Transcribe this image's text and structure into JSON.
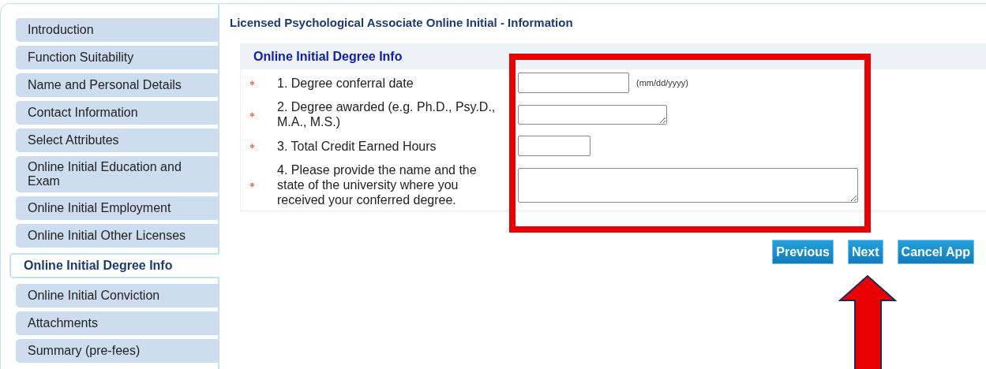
{
  "sidebar": {
    "items": [
      {
        "label": "Introduction",
        "selected": false
      },
      {
        "label": "Function Suitability",
        "selected": false
      },
      {
        "label": "Name and Personal Details",
        "selected": false
      },
      {
        "label": "Contact Information",
        "selected": false
      },
      {
        "label": "Select Attributes",
        "selected": false
      },
      {
        "label": "Online Initial Education and Exam",
        "selected": false
      },
      {
        "label": "Online Initial Employment",
        "selected": false
      },
      {
        "label": "Online Initial Other Licenses",
        "selected": false
      },
      {
        "label": "Online Initial Degree Info",
        "selected": true
      },
      {
        "label": "Online Initial Conviction",
        "selected": false
      },
      {
        "label": "Attachments",
        "selected": false
      },
      {
        "label": "Summary (pre-fees)",
        "selected": false
      }
    ]
  },
  "page_title": "Licensed Psychological Associate Online Initial - Information",
  "section": {
    "title": "Online Initial Degree Info",
    "fields": [
      {
        "label": "1. Degree conferral date",
        "required": true,
        "kind": "date",
        "hint": "(mm/dd/yyyy)"
      },
      {
        "label": "2. Degree awarded (e.g. Ph.D., Psy.D., M.A., M.S.)",
        "required": true,
        "kind": "textarea-small"
      },
      {
        "label": "3. Total Credit Earned Hours",
        "required": true,
        "kind": "short"
      },
      {
        "label": "4. Please provide the name and the state of the university where you received your conferred degree.",
        "required": true,
        "kind": "textarea-large"
      }
    ]
  },
  "buttons": [
    "Previous",
    "Next",
    "Cancel App"
  ],
  "annotations": {
    "highlight_box": true,
    "arrow": true
  }
}
